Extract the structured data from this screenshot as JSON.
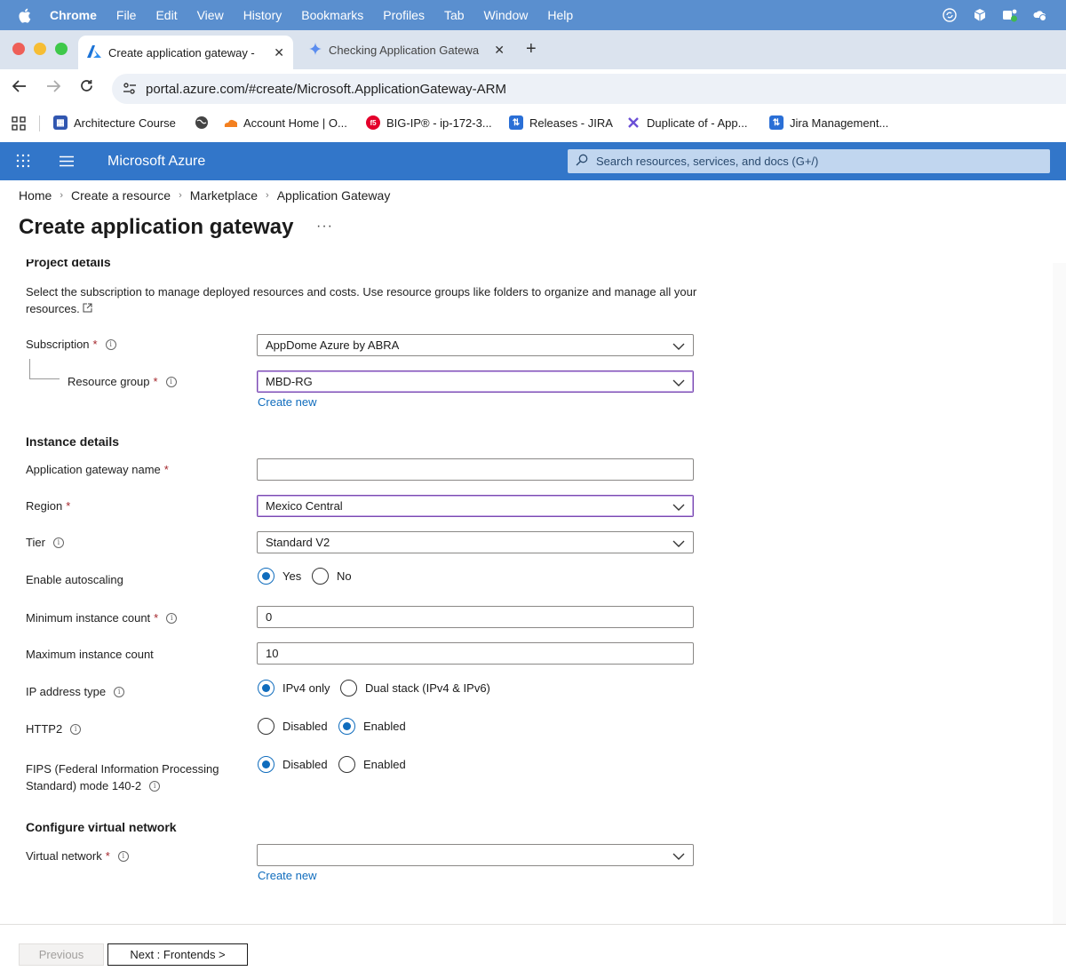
{
  "menubar": {
    "app": "Chrome",
    "items": [
      "File",
      "Edit",
      "View",
      "History",
      "Bookmarks",
      "Profiles",
      "Tab",
      "Window",
      "Help"
    ]
  },
  "tabs": [
    {
      "title": "Create application gateway -",
      "active": true
    },
    {
      "title": "Checking Application Gatewa",
      "active": false
    }
  ],
  "address": {
    "url": "portal.azure.com/#create/Microsoft.ApplicationGateway-ARM"
  },
  "bookmarks": [
    "Architecture Course",
    "Account Home | O...",
    "BIG-IP® - ip-172-3...",
    "Releases - JIRA",
    "Duplicate of - App...",
    "Jira Management..."
  ],
  "azure": {
    "brand": "Microsoft Azure",
    "search_placeholder": "Search resources, services, and docs (G+/)"
  },
  "breadcrumb": [
    "Home",
    "Create a resource",
    "Marketplace",
    "Application Gateway"
  ],
  "page": {
    "title": "Create application gateway",
    "more": "···"
  },
  "project": {
    "heading": "Project details",
    "description": "Select the subscription to manage deployed resources and costs. Use resource groups like folders to organize and manage all your resources.",
    "subscription_label": "Subscription",
    "subscription_value": "AppDome Azure by ABRA",
    "resource_group_label": "Resource group",
    "resource_group_value": "MBD-RG",
    "create_new": "Create new"
  },
  "instance": {
    "heading": "Instance details",
    "name_label": "Application gateway name",
    "name_value": "",
    "region_label": "Region",
    "region_value": "Mexico Central",
    "tier_label": "Tier",
    "tier_value": "Standard V2",
    "autoscale_label": "Enable autoscaling",
    "autoscale_yes": "Yes",
    "autoscale_no": "No",
    "min_label": "Minimum instance count",
    "min_value": "0",
    "max_label": "Maximum instance count",
    "max_value": "10",
    "ip_label": "IP address type",
    "ip_v4": "IPv4 only",
    "ip_dual": "Dual stack (IPv4 & IPv6)",
    "http2_label": "HTTP2",
    "http2_disabled": "Disabled",
    "http2_enabled": "Enabled",
    "fips_label_1": "FIPS (Federal Information Processing",
    "fips_label_2": "Standard) mode 140-2",
    "fips_disabled": "Disabled",
    "fips_enabled": "Enabled"
  },
  "vnet": {
    "heading": "Configure virtual network",
    "label": "Virtual network",
    "value": "",
    "create_new": "Create new"
  },
  "footer": {
    "previous": "Previous",
    "next": "Next : Frontends >"
  },
  "colors": {
    "azure_header": "#3276c9",
    "link": "#0f6cbd",
    "required": "#a4262c",
    "focus_border": "#7a4bb0"
  }
}
